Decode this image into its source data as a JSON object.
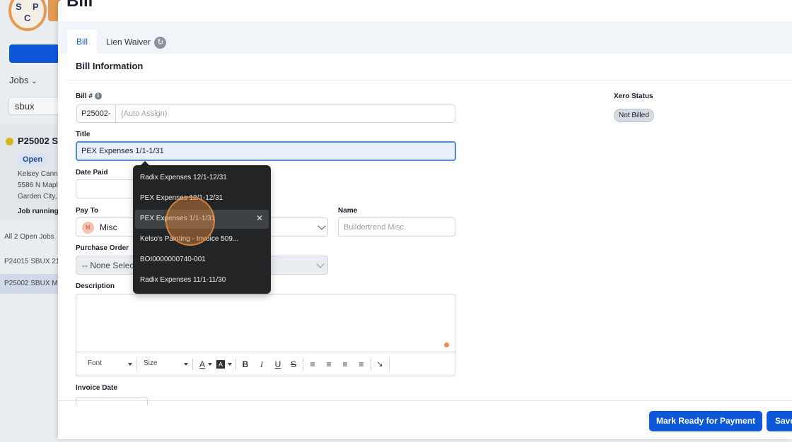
{
  "background": {
    "jobs_label": "Jobs",
    "search_value": "sbux",
    "job_title": "P25002 S",
    "job_status": "Open",
    "address_lines": [
      "Kelsey Cannc",
      "5586 N Mapl",
      "Garden City,"
    ],
    "job_running": "Job running",
    "list_heading": "All 2 Open Jobs",
    "list_items": [
      "P24015 SBUX 21s",
      "P25002 SBUX Ma"
    ]
  },
  "modal": {
    "title": "Bill",
    "tabs": [
      {
        "label": "Bill",
        "active": true
      },
      {
        "label": "Lien Waiver",
        "icon": "sync-icon",
        "active": false
      }
    ],
    "section_title": "Bill Information"
  },
  "form": {
    "bill_number": {
      "label": "Bill #",
      "prefix": "P25002-",
      "placeholder": "(Auto Assign)"
    },
    "title": {
      "label": "Title",
      "value": "PEX Expenses 1/1-1/31"
    },
    "date_paid": {
      "label": "Date Paid"
    },
    "pay_to": {
      "label": "Pay To",
      "avatar_initial": "M",
      "value": "Misc"
    },
    "name": {
      "label": "Name",
      "placeholder": "Buildertrend Misc."
    },
    "purchase_order": {
      "label": "Purchase Order",
      "value": "-- None Select"
    },
    "description": {
      "label": "Description"
    },
    "invoice_date": {
      "label": "Invoice Date"
    },
    "toolbar": {
      "font": "Font",
      "size": "Size"
    }
  },
  "xero": {
    "label": "Xero Status",
    "status": "Not Billed"
  },
  "autocomplete": {
    "items": [
      "Radix Expenses 12/1-12/31",
      "PEX Expenses 12/1-12/31",
      "PEX Expenses 1/1-1/31",
      "Kelso's Painting  - Invoice 509...",
      "BOI0000000740-001",
      "Radix Expenses 11/1-11/30"
    ],
    "highlighted_index": 2
  },
  "footer": {
    "mark_ready_label": "Mark Ready for Payment",
    "save_label": "Save"
  },
  "colors": {
    "primary": "#0d57d9",
    "focus_border": "#4f8bd8",
    "menu_bg": "#222426",
    "click_marker": "#e5893f"
  }
}
